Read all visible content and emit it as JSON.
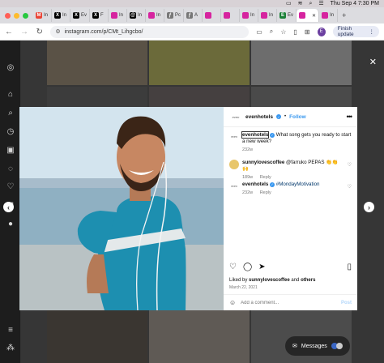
{
  "menubar": {
    "date_time": "Thu Sep 4  7:30 PM"
  },
  "tabs": [
    {
      "label": "In",
      "icon": "gmail-icon",
      "color": "#ea4335",
      "glyph": "M"
    },
    {
      "label": "In",
      "icon": "x-icon",
      "color": "#000000",
      "glyph": "X"
    },
    {
      "label": "Ev",
      "icon": "x-icon",
      "color": "#000000",
      "glyph": "X"
    },
    {
      "label": "F",
      "icon": "x-icon",
      "color": "#000000",
      "glyph": "X"
    },
    {
      "label": "In",
      "icon": "instagram-icon",
      "color": "#d6249f",
      "glyph": ""
    },
    {
      "label": "In",
      "icon": "threads-icon",
      "color": "#000000",
      "glyph": "@"
    },
    {
      "label": "In",
      "icon": "instagram-icon",
      "color": "#d6249f",
      "glyph": ""
    },
    {
      "label": "Pc",
      "icon": "script-icon",
      "color": "#777777",
      "glyph": "ƒ"
    },
    {
      "label": "A",
      "icon": "script-icon",
      "color": "#777777",
      "glyph": "ƒ"
    },
    {
      "label": "",
      "icon": "instagram-icon",
      "color": "#d6249f",
      "glyph": ""
    },
    {
      "label": "",
      "icon": "instagram-icon",
      "color": "#d6249f",
      "glyph": ""
    },
    {
      "label": "In",
      "icon": "instagram-icon",
      "color": "#d6249f",
      "glyph": ""
    },
    {
      "label": "In",
      "icon": "instagram-icon",
      "color": "#d6249f",
      "glyph": ""
    },
    {
      "label": "Ev",
      "icon": "green-icon",
      "color": "#1a7f37",
      "glyph": "E"
    },
    {
      "label": "",
      "icon": "instagram-icon",
      "color": "#d6249f",
      "glyph": "",
      "active": true,
      "close": "✕"
    },
    {
      "label": "In",
      "icon": "instagram-icon",
      "color": "#d6249f",
      "glyph": ""
    }
  ],
  "toolbar": {
    "url": "instagram.com/p/CMt_Lihgcbo/",
    "profile_initial": "E",
    "finish_update": "Finish update"
  },
  "post": {
    "username": "evenhotels",
    "follow": "Follow",
    "logo_text": "even",
    "caption_user": "evenhotels",
    "caption": "What song gets you ready to start a new week?",
    "caption_time": "232w",
    "comments": [
      {
        "user": "sunnylovescoffee",
        "text": "@farruko PEPAS 👏👏🙌",
        "time": "189w",
        "reply": "Reply"
      },
      {
        "user": "evenhotels",
        "text": "#MondayMotivation",
        "time": "232w",
        "reply": "Reply"
      }
    ],
    "liked_prefix": "Liked by ",
    "liked_user": "sunnylovescoffee",
    "liked_mid": " and ",
    "liked_others": "others",
    "date": "March 22, 2021",
    "add_comment_placeholder": "Add a comment...",
    "post_button": "Post"
  },
  "messages_label": "Messages",
  "colors": {
    "accent": "#3797ef",
    "instagram": "#d6249f"
  }
}
